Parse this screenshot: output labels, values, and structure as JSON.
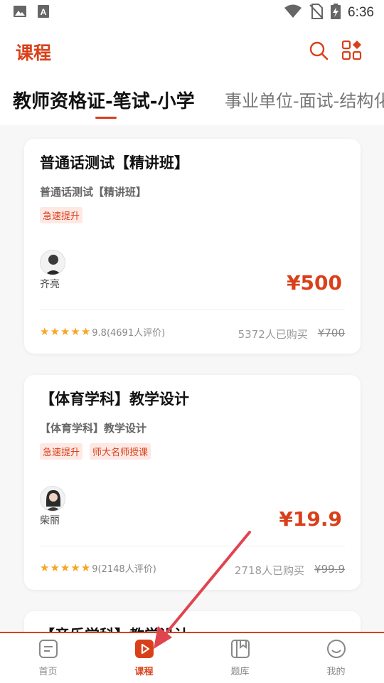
{
  "status_bar": {
    "time": "6:36"
  },
  "header": {
    "title": "课程",
    "search_icon": "search-icon",
    "apps_icon": "apps-icon"
  },
  "tabs": [
    {
      "label": "教师资格证-笔试-小学",
      "active": true
    },
    {
      "label": "事业单位-面试-结构化",
      "active": false
    }
  ],
  "courses": [
    {
      "title": "普通话测试【精讲班】",
      "subtitle": "普通话测试【精讲班】",
      "tags": [
        "急速提升"
      ],
      "teacher": "齐亮",
      "price": "¥500",
      "rating": "9.8(4691人评价)",
      "stars": 5,
      "sold": "5372人已购买",
      "original_price": "¥700"
    },
    {
      "title": "【体育学科】教学设计",
      "subtitle": "【体育学科】教学设计",
      "tags": [
        "急速提升",
        "师大名师授课"
      ],
      "teacher": "柴丽",
      "price": "¥19.9",
      "rating": "9(2148人评价)",
      "stars": 5,
      "sold": "2718人已购买",
      "original_price": "¥99.9"
    },
    {
      "title": "【音乐学科】教学设计"
    }
  ],
  "bottom_nav": [
    {
      "label": "首页",
      "icon": "home-icon",
      "active": false
    },
    {
      "label": "课程",
      "icon": "play-icon",
      "active": true
    },
    {
      "label": "题库",
      "icon": "book-icon",
      "active": false
    },
    {
      "label": "我的",
      "icon": "profile-icon",
      "active": false
    }
  ],
  "colors": {
    "accent": "#d9401a",
    "star": "#f5a623",
    "arrow": "#e0454f"
  }
}
